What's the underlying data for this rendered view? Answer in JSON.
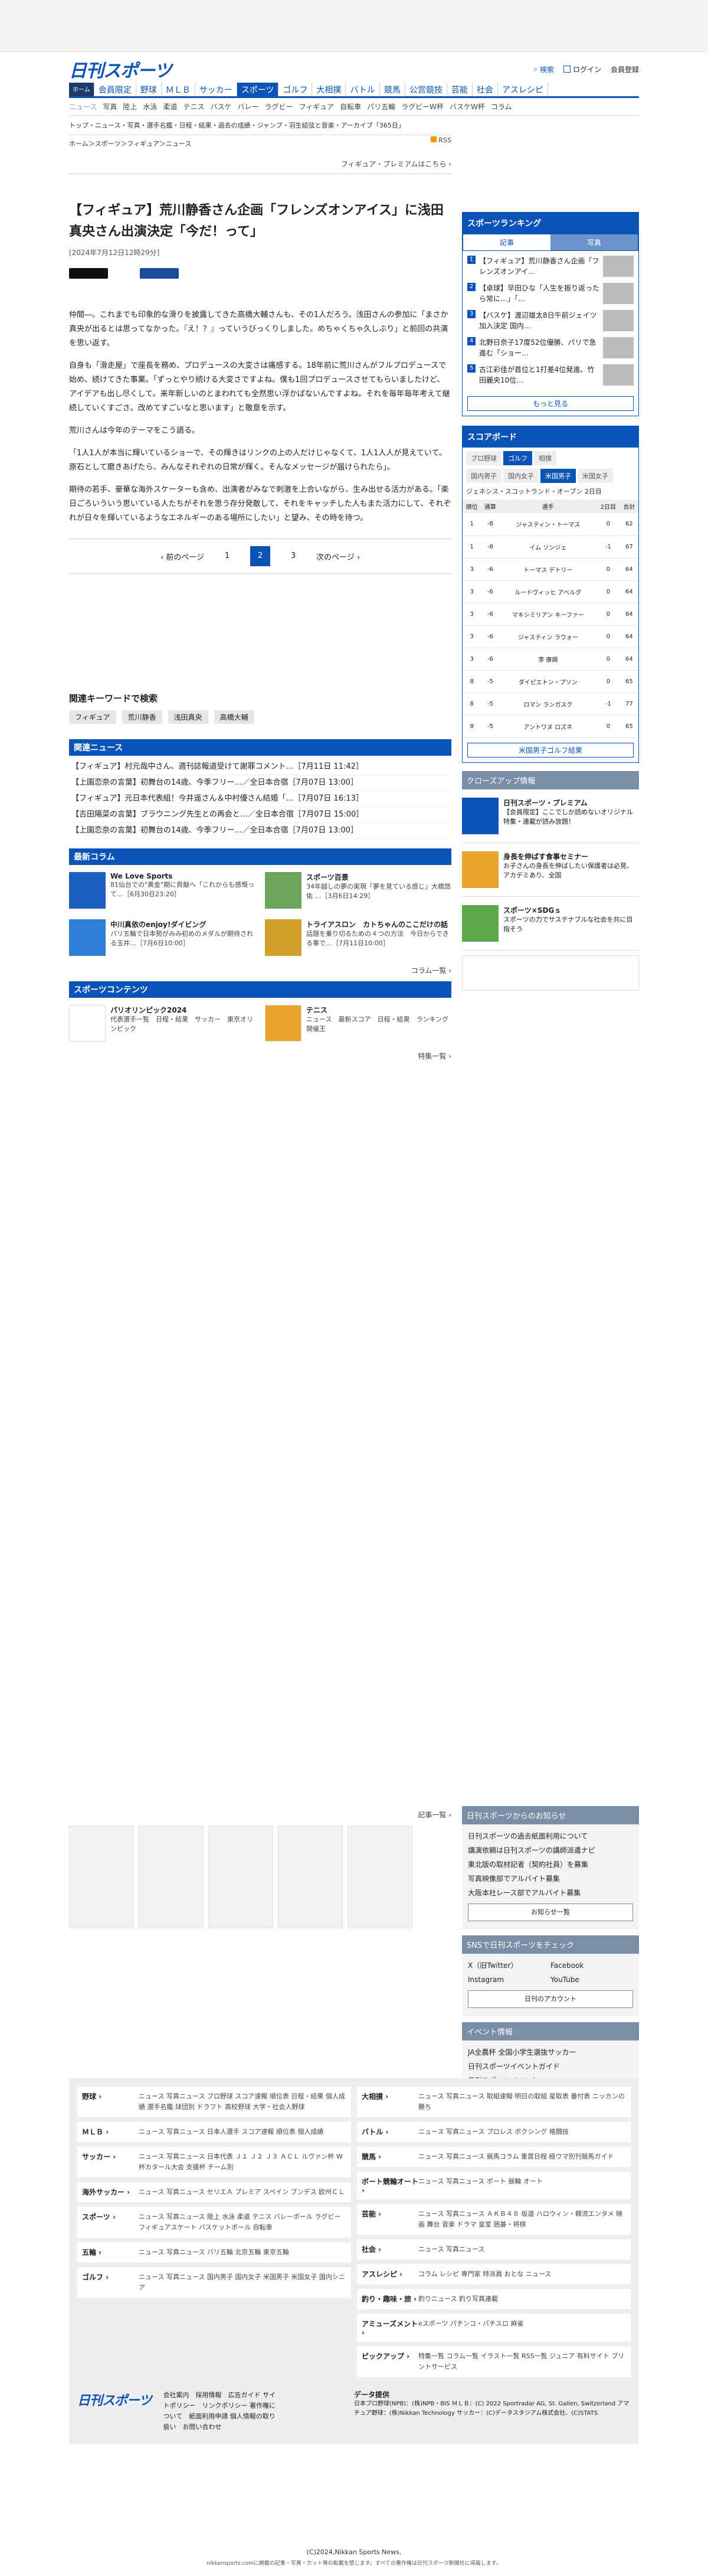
{
  "header": {
    "logo": "日刊スポーツ",
    "search": "検索",
    "login": "ログイン",
    "register": "会員登録"
  },
  "gnav": [
    "ホーム",
    "会員限定",
    "野球",
    "ＭＬＢ",
    "サッカー",
    "スポーツ",
    "ゴルフ",
    "大相撲",
    "バトル",
    "競馬",
    "公営競技",
    "芸能",
    "社会",
    "アスレシピ"
  ],
  "subnav": [
    "ニュース",
    "写真",
    "陸上",
    "水泳",
    "柔道",
    "テニス",
    "バスケ",
    "バレー",
    "ラグビー",
    "フィギュア",
    "自転車",
    "パリ五輪",
    "ラグビーW杯",
    "バスケW杯",
    "コラム"
  ],
  "crumbs": {
    "line1": "トップ・ニュース・写真・選手名鑑・日程・結果・過去の成績・ジャンプ・羽生結弦と音楽・アーカイブ「365日」",
    "line2": "ホーム＞スポーツ＞フィギュア＞ニュース",
    "rss": "RSS"
  },
  "article": {
    "fp": "フィギュア・プレミアムはこちら ›",
    "title": "【フィギュア】荒川静香さん企画「フレンズオンアイス」に浅田真央さん出演決定「今だ！って」",
    "date": "[2024年7月12日12時29分]",
    "p1": "仲間―。これまでも印象的な滑りを披露してきた高橋大輔さんも、その1人だろう。浅田さんの参加に「まさか真央が出るとは思ってなかった。『え！？』っていうびっくりしました。めちゃくちゃ久しぶり」と前回の共演を思い返す。",
    "p2": "自身も「滑走屋」で座長を務め、プロデュースの大変さは痛感する。18年前に荒川さんがフルプロデュースで始め、続けてきた事業。「ずっとやり続ける大変さですよね。僕も1回プロデュースさせてもらいましたけど、アイデアも出し尽くして。来年新しいのとまわれても全然思い浮かばないんですよね。それを毎年毎年考えて継続していくすごさ。改めてすごいなと思います」と敬意を示す。",
    "p3": "荒川さんは今年のテーマをこう語る。",
    "p4": "「1人1人が本当に輝いているショーで、その輝きはリンクの上の人だけじゃなくて、1人1人人が見えていて。原石として磨きあげたら、みんなそれぞれの日常が輝く。そんなメッセージが届けられたら」。",
    "p5": "期待の若手、豪華な海外スケーターも含め、出演者がみなで刺激を上合いながら、生み出せる活力がある。「楽日ごろいういう思いている人たちがそれを思う存分発散して、それをキャッチした人もまた活力にして、それぞれが日々を輝いているようなエネルギーのある場所にしたい」と望み、その時を待つ。"
  },
  "pager": {
    "prev": "‹ 前のページ",
    "p1": "1",
    "p2": "2",
    "p3": "3",
    "next": "次のページ ›"
  },
  "keywords": {
    "title": "関連キーワードで検索",
    "items": [
      "フィギュア",
      "荒川静香",
      "浅田真央",
      "高橋大輔"
    ]
  },
  "related": {
    "title": "関連ニュース",
    "items": [
      "【フィギュア】村元哉中さん、週刊誌報道受けて謝罪コメント…［7月11日 11:42］",
      "【上園恋奈の言葉】初舞台の14歳、今季フリー…／全日本合宿［7月07日 13:00］",
      "【フィギュア】元日本代表組！今井遥さん＆中村優さん結婚「…［7月07日 16:13］",
      "【吉田陽菜の言葉】ブラウニング先生との再会と…／全日本合宿［7月07日 15:00］",
      "【上園恋奈の言葉】初舞台の14歳、今季フリー…／全日本合宿［7月07日 13:00］"
    ]
  },
  "columns": {
    "title": "最新コラム",
    "items": [
      {
        "t": "We Love Sports",
        "x": "81仙台での\"黄金\"期に貢献へ「これからも感慨って…［6月30日23:20］"
      },
      {
        "t": "スポーツ百景",
        "x": "34年越しの夢の実現「夢を見ている感じ」大橋悠佑 …［3月6日14:29］"
      },
      {
        "t": "中川真依のenjoy!ダイビング",
        "x": "パリ五輪で日本勢がみみ初めのメダルが期待される玉井…［7月6日10:00］"
      },
      {
        "t": "トライアスロン　カトちゃんのここだけの話",
        "x": "話題を乗り切るための４つの方法　今日からできる事で…［7月11日10:00］"
      }
    ],
    "more": "コラム一覧 ›"
  },
  "contents": {
    "title": "スポーツコンテンツ",
    "items": [
      {
        "t": "パリオリンピック2024",
        "x": "代表選手一覧　日程・結果　サッカー　東京オリンピック"
      },
      {
        "t": "テニス",
        "x": "ニュース　最新スコア　日程・結果　ランキング　開催王"
      }
    ],
    "more": "特集一覧 ›"
  },
  "ranking": {
    "title": "スポーツランキング",
    "tab1": "記事",
    "tab2": "写真",
    "items": [
      "【フィギュア】荒川静香さん企画「フレンズオンアイ…",
      "【卓球】早田ひな「人生を振り返ったら常に…」「…",
      "【バスケ】渡辺雄太8日午前ジェイツ加入決定 国内…",
      "北野日奈子17度52位優勝、パリで急進む「ショー…",
      "古江彩佳が首位と1打差4位発進、竹田麗央10位…"
    ],
    "more": "もっと見る"
  },
  "scoreboard": {
    "title": "スコアボード",
    "tabs": [
      "プロ野球",
      "ゴルフ",
      "相撲"
    ],
    "sub": [
      "国内男子",
      "国内女子",
      "米国男子",
      "米国女子"
    ],
    "tourn": "ジェネシス・スコットランド・オープン 2日目",
    "head": [
      "順位",
      "通算",
      "選手",
      "2日目",
      "合計"
    ],
    "rows": [
      [
        "1",
        "-8",
        "ジャスティン・トーマス",
        "0",
        "62"
      ],
      [
        "1",
        "-8",
        "イム ソンジェ",
        "-1",
        "67"
      ],
      [
        "3",
        "-6",
        "トーマス デトリー",
        "0",
        "64"
      ],
      [
        "3",
        "-6",
        "ルードヴィッヒ アベルグ",
        "0",
        "64"
      ],
      [
        "3",
        "-6",
        "マキシミリアン キーファー",
        "0",
        "64"
      ],
      [
        "3",
        "-6",
        "ジャスティン ラウォー",
        "0",
        "64"
      ],
      [
        "3",
        "-6",
        "李 康錫",
        "0",
        "64"
      ],
      [
        "8",
        "-5",
        "ダイピエトン・プソン",
        "0",
        "65"
      ],
      [
        "8",
        "-5",
        "ロマン ランガスク",
        "-1",
        "77"
      ],
      [
        "8",
        "-5",
        "アントワヌ ロズネ",
        "0",
        "65"
      ]
    ],
    "link": "米国男子ゴルフ結果"
  },
  "closeup": {
    "title": "クローズアップ情報",
    "items": [
      {
        "t": "日刊スポーツ・プレミアム",
        "x": "【会員限定】ここでしか読めないオリジナル特集・連載が読み放題！"
      },
      {
        "t": "身長を伸ばす食事セミナー",
        "x": "お子さんの身長を伸ばしたい保護者は必見、アカデミあり、全国"
      },
      {
        "t": "スポーツ×SDGｓ",
        "x": "スポーツの力でサステナブルな社会を共に目指そう"
      }
    ]
  },
  "notice": {
    "title": "日刊スポーツからのお知らせ",
    "items": [
      "日刊スポーツの過去紙面利用について",
      "講演依頼は日刊スポーツの講師派遣ナビ",
      "東北版の取材記者（契約社員）を募集",
      "写真映像部でアルバイト募集",
      "大阪本社レース部でアルバイト募集"
    ],
    "btn": "お知らせ一覧"
  },
  "sns": {
    "title": "SNSで日刊スポーツをチェック",
    "x": "X（旧Twitter）",
    "fb": "Facebook",
    "ig": "Instagram",
    "yt": "YouTube",
    "btn": "日刊のアカウント"
  },
  "events": {
    "title": "イベント情報",
    "items": [
      "JA全農杯 全国小学生選抜サッカー",
      "日刊スポーツイベントガイド",
      "日刊スポーツイベント",
      "美になる情報（広告企画）"
    ]
  },
  "adsmore": "記事一覧 ›",
  "footer": {
    "left": [
      {
        "h": "野球",
        "l": "ニュース 写真ニュース プロ野球 スコア速報 順位表 日程・結果 個人成績 選手名鑑 球団別 ドラフト 高校野球 大学・社会人野球"
      },
      {
        "h": "ＭＬＢ",
        "l": "ニュース 写真ニュース 日本人選手 スコア速報 順位表 個人成績"
      },
      {
        "h": "サッカー",
        "l": "ニュース 写真ニュース 日本代表 Ｊ１ Ｊ２ Ｊ３ ＡＣＬ ルヴァン杯 W杯カタール大会 支援杯 チーム別"
      },
      {
        "h": "海外サッカー",
        "l": "ニュース 写真ニュース セリエＡ プレミア スペイン ブンデス 欧州ＣＬ"
      },
      {
        "h": "スポーツ",
        "l": "ニュース 写真ニュース 陸上 水泳 柔道 テニス バレーボール ラグビー フィギュアスケート バスケットボール 自転車"
      },
      {
        "h": "五輪",
        "l": "ニュース 写真ニュース パリ五輪 北京五輪 東京五輪"
      },
      {
        "h": "ゴルフ",
        "l": "ニュース 写真ニュース 国内男子 国内女子 米国男子 米国女子 国内シニア"
      }
    ],
    "right": [
      {
        "h": "大相撲",
        "l": "ニュース 写真ニュース 取組速報 明日の取組 星取表 番付表 ニッカンの勝ち"
      },
      {
        "h": "バトル",
        "l": "ニュース 写真ニュース プロレス ボクシング 格闘技"
      },
      {
        "h": "競馬",
        "l": "ニュース 写真ニュース 競馬コラム 重賞日程 極ウマ別刊競馬ガイド"
      },
      {
        "h": "ボート競輪オート",
        "l": "ニュース 写真ニュース ボート 競輪 オート"
      },
      {
        "h": "芸能",
        "l": "ニュース 写真ニュース ＡＫＢ４８ 坂道 ハロウィン・韓流エンタメ 映画 舞台 音楽 ドラマ 皇室 囲碁・将棋"
      },
      {
        "h": "社会",
        "l": "ニュース 写真ニュース"
      },
      {
        "h": "アスレシピ",
        "l": "コラム レシピ 専門家 特派員 おとな ニュース"
      },
      {
        "h": "釣り・趣味・旅",
        "l": "釣りニュース 釣り写真連載"
      },
      {
        "h": "アミューズメント",
        "l": "eスポーツ パチンコ・パチスロ 麻雀"
      },
      {
        "h": "ピックアップ",
        "l": "特集一覧 コラム一覧 イラスト一覧 RSS一覧 ジュニア 有料サイト プリントサービス"
      }
    ],
    "logo": "日刊スポーツ",
    "links": "会社案内　採用情報　広告ガイド サイトポリシー　リンクポリシー 著作権について　紙面利用申請 個人情報の取り扱い　お問い合わせ",
    "data": "データ提供",
    "datatext": "日本プロ野球(NPB)：(株)NPB・BIS ＭＬＢ：(C) 2022 Sportradar AG, St. Gallen, Switzerland アマチュア野球：(株)Nikkan Technology サッカー：(C)データスタジアム株式会社、(C)STATS"
  },
  "copyright": "(C)2024,Nikkan Sports News.",
  "notice_small": "nikkansports.comに掲載の記事・写真・カット等の転載を禁じます。すべての著作権は日刊スポーツ新聞社に帰属します。"
}
